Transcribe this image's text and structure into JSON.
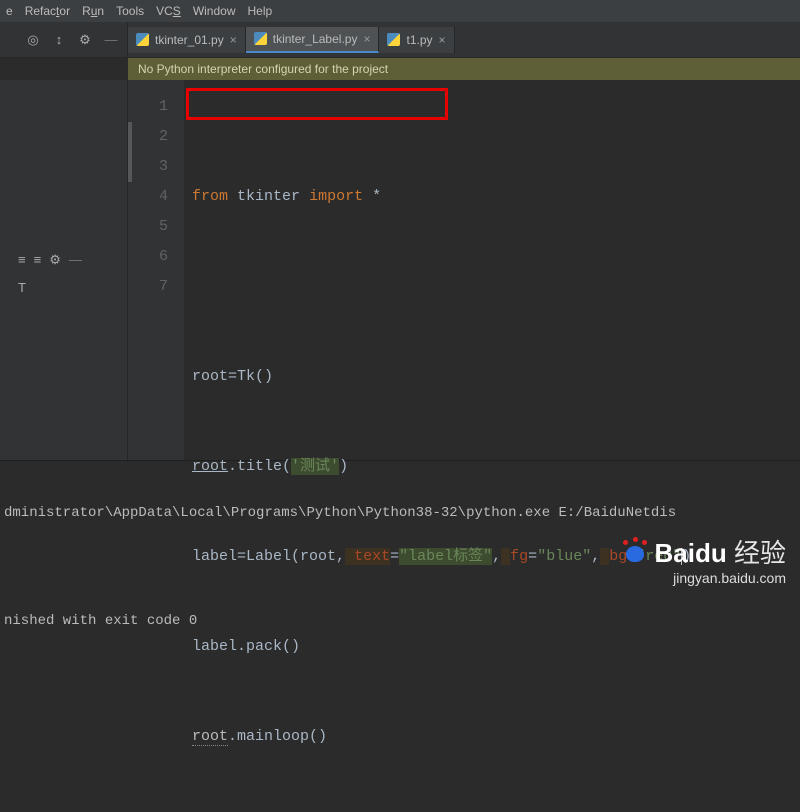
{
  "menu": {
    "items": [
      "e",
      "Refactor",
      "Run",
      "Tools",
      "VCS",
      "Window",
      "Help"
    ],
    "under": [
      0,
      5,
      0,
      0,
      2,
      0,
      0
    ]
  },
  "toolbar": {
    "gear": "⚙",
    "dash": "—"
  },
  "tabs": [
    {
      "label": "tkinter_01.py",
      "active": false
    },
    {
      "label": "tkinter_Label.py",
      "active": true
    },
    {
      "label": "t1.py",
      "active": false
    }
  ],
  "warning": "No Python interpreter configured for the project",
  "code": {
    "from": "from",
    "tkinter": "tkinter",
    "import": "import",
    "star": " *",
    "root": "root",
    "eq": "=",
    "Tk": "Tk()",
    "dot": ".",
    "title": "title(",
    "title_str": "'测试'",
    "cparen": ")",
    "label": "label",
    "Label": "Label(root",
    "comma": ",",
    "w": " ",
    "p_text": "text",
    "s_label": "\"label标签\"",
    "p_fg": "fg",
    "s_blue": "\"blue\"",
    "p_bg": "bg",
    "s_red": "\"red\"",
    "pack": "pack()",
    "mainloop": "mainloop()"
  },
  "line_numbers": [
    "1",
    "2",
    "3",
    "4",
    "5",
    "6",
    "7"
  ],
  "console": {
    "path": "dministrator\\AppData\\Local\\Programs\\Python\\Python38-32\\python.exe E:/BaiduNetdis",
    "exit": "nished with exit code 0"
  },
  "watermark": {
    "brand": "Baidu",
    "cn": "经验",
    "url": "jingyan.baidu.com"
  }
}
